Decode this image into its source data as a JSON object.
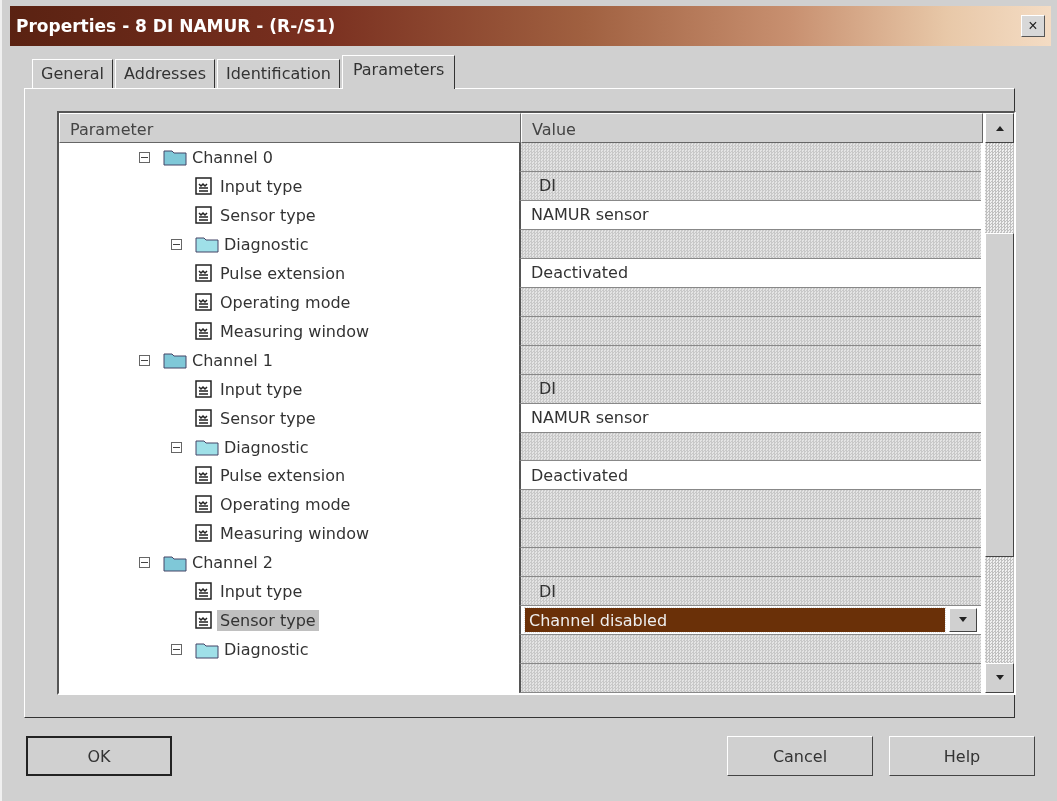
{
  "window": {
    "title": "Properties - 8 DI NAMUR - (R-/S1)",
    "close": "×"
  },
  "tabs": [
    {
      "label": "General",
      "selected": false
    },
    {
      "label": "Addresses",
      "selected": false
    },
    {
      "label": "Identification",
      "selected": false
    },
    {
      "label": "Parameters",
      "selected": true
    }
  ],
  "table": {
    "columns": [
      "Parameter",
      "Value"
    ],
    "rows": [
      {
        "label": "Channel 0",
        "kind": "folder",
        "expanded": true,
        "children": [
          {
            "label": "Input type",
            "kind": "leaf",
            "selected": false,
            "value": "DI",
            "editable": false
          },
          {
            "label": "Sensor type",
            "kind": "leaf",
            "selected": false,
            "value": "NAMUR sensor",
            "editable": true
          },
          {
            "label": "Diagnostic",
            "kind": "folder",
            "expanded": true,
            "children": [
              {
                "label": "Pulse extension",
                "kind": "leaf",
                "selected": false,
                "value": "Deactivated",
                "editable": true
              },
              {
                "label": "Operating mode",
                "kind": "leaf",
                "selected": false,
                "editable": false
              },
              {
                "label": "Measuring window",
                "kind": "leaf",
                "selected": false,
                "editable": false
              }
            ]
          }
        ]
      },
      {
        "label": "Channel 1",
        "kind": "folder",
        "expanded": true,
        "children": [
          {
            "label": "Input type",
            "kind": "leaf",
            "selected": false,
            "value": "DI",
            "editable": false
          },
          {
            "label": "Sensor type",
            "kind": "leaf",
            "selected": false,
            "value": "NAMUR sensor",
            "editable": true
          },
          {
            "label": "Diagnostic",
            "kind": "folder",
            "expanded": true,
            "children": [
              {
                "label": "Pulse extension",
                "kind": "leaf",
                "selected": false,
                "value": "Deactivated",
                "editable": true
              },
              {
                "label": "Operating mode",
                "kind": "leaf",
                "selected": false,
                "editable": false
              },
              {
                "label": "Measuring window",
                "kind": "leaf",
                "selected": false,
                "editable": false
              }
            ]
          }
        ]
      },
      {
        "label": "Channel 2",
        "kind": "folder",
        "expanded": true,
        "children": [
          {
            "label": "Input type",
            "kind": "leaf",
            "selected": false,
            "value": "DI",
            "editable": false
          },
          {
            "label": "Sensor type",
            "kind": "leaf",
            "selected": true,
            "value": "Channel disabled",
            "editable": true
          },
          {
            "label": "Diagnostic",
            "kind": "folder",
            "expanded": true
          }
        ]
      }
    ]
  },
  "buttons": [
    {
      "label": "OK",
      "kind": "default"
    },
    {
      "label": "Cancel",
      "kind": "normal"
    },
    {
      "label": "Help",
      "kind": "normal"
    }
  ]
}
